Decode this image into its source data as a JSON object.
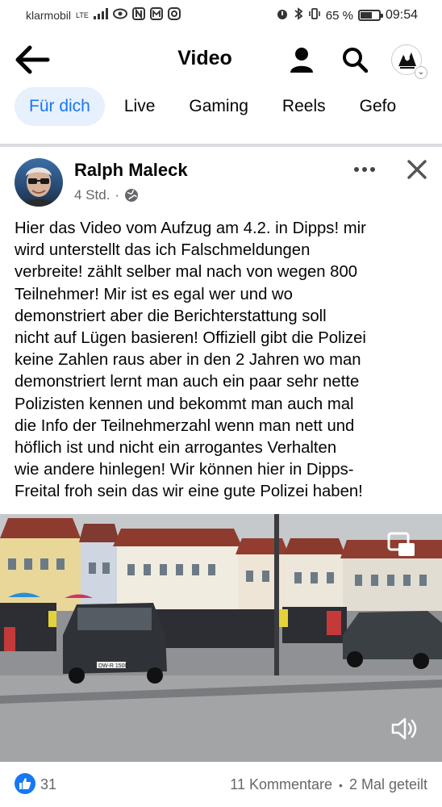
{
  "status_bar": {
    "carrier": "klarmobil",
    "network": "LTE",
    "battery_percent": "65 %",
    "battery_level": 0.65,
    "time": "09:54"
  },
  "header": {
    "title": "Video",
    "icons": [
      "back-arrow-icon",
      "person-icon",
      "search-icon",
      "profile-avatar"
    ]
  },
  "tabs": [
    {
      "label": "Für dich",
      "active": true
    },
    {
      "label": "Live",
      "active": false
    },
    {
      "label": "Gaming",
      "active": false
    },
    {
      "label": "Reels",
      "active": false
    },
    {
      "label": "Gefo",
      "active": false
    }
  ],
  "post": {
    "author": "Ralph Maleck",
    "time": "4 Std.",
    "visibility_icon": "globe-icon",
    "text": "Hier das Video vom Aufzug am 4.2. in Dipps! mir\nwird unterstellt das ich Falschmeldungen\nverbreite!  zählt selber mal nach von wegen 800\nTeilnehmer! Mir ist es egal wer und wo\ndemonstriert aber die Berichterstattung soll\nnicht auf Lügen basieren! Offiziell gibt die Polizei\nkeine Zahlen raus aber in den 2 Jahren wo man\ndemonstriert lernt man auch ein paar sehr nette\nPolizisten kennen und bekommt man auch mal\ndie Info der Teilnehmerzahl wenn man nett und\nhöflich ist und nicht ein  arrogantes Verhalten\nwie andere hinlegen! Wir können hier in Dipps-\nFreital froh sein das wir eine gute Polizei haben!",
    "video": {
      "license_plate": "DW-R 1500"
    }
  },
  "footer": {
    "likes": "31",
    "comments": "11 Kommentare",
    "separator": "•",
    "shares": "2 Mal geteilt"
  },
  "colors": {
    "accent": "#1877f2",
    "active_tab_bg": "#e7f0fd",
    "meta_text": "#65676b"
  }
}
